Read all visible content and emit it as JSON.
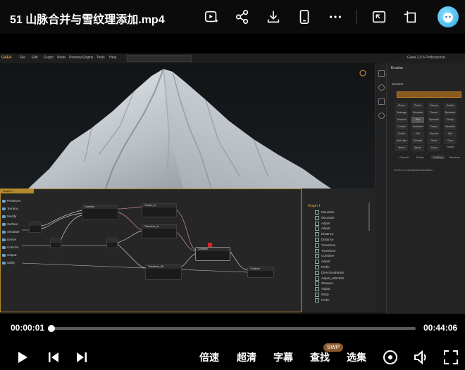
{
  "header": {
    "title": "51 山脉合并与雪纹理添加.mp4",
    "icons": [
      "play-collection-icon",
      "share-icon",
      "download-icon",
      "phone-icon",
      "more-icon",
      "picture-in-picture-icon",
      "exit-fullscreen-icon"
    ]
  },
  "app": {
    "logo": "GAEA",
    "menu": [
      "File",
      "Edit",
      "Graph",
      "Node",
      "Preview",
      "Engine",
      "Tools",
      "Help"
    ],
    "edition": "Gaea 2.0.5 Professional",
    "library": [
      "Primitives",
      "Terrains",
      "Modify",
      "Surface",
      "Simulate",
      "Derive",
      "Colorize",
      "Output",
      "Utility"
    ],
    "library_header": "Graph 1",
    "outline_root": "Graph 1",
    "outline_items": [
      "Mountain",
      "Mountain",
      "Adjust",
      "Adjust",
      "Distance",
      "Distance",
      "Transform",
      "Transform",
      "Combine",
      "Adjust",
      "Perlin",
      "DirectionalWarp",
      "Adjust_ab8c961",
      "Sharpen",
      "Adjust",
      "Warp",
      "Perlin"
    ],
    "nodes": [
      "Combine",
      "Terrace_A",
      "Transform_A",
      "Transform_AB",
      "Combine",
      "Combine"
    ],
    "panel_title": "Erosion",
    "panel_section": "Erosion",
    "erosion_presets": [
      "Rivers",
      "Fluvial",
      "Canyon",
      "Gullies",
      "Drainage",
      "Mountain",
      "Desert",
      "Badlands",
      "Terraces",
      "Wet",
      "Hydraulic",
      "Sharp",
      "Eroded",
      "Sediment",
      "Dunes",
      "Bevelled",
      "Subtle",
      "Flat",
      "Smooth",
      "Soft",
      "Soft Light",
      "Delicate",
      "Sand Smooth",
      "Cave Forest",
      "Mixed",
      "Alpine",
      "Snow"
    ],
    "panel_tabs": [
      "Overall",
      "Erode",
      "Cutting",
      "Structure"
    ],
    "description": "Erosion is a geophysical simulation..."
  },
  "controls": {
    "current_time": "00:00:01",
    "total_time": "00:44:06",
    "progress": 0.002,
    "speed": "倍速",
    "quality": "超清",
    "subtitle": "字幕",
    "search": "查找",
    "search_badge": "SWP",
    "episodes": "选集"
  }
}
